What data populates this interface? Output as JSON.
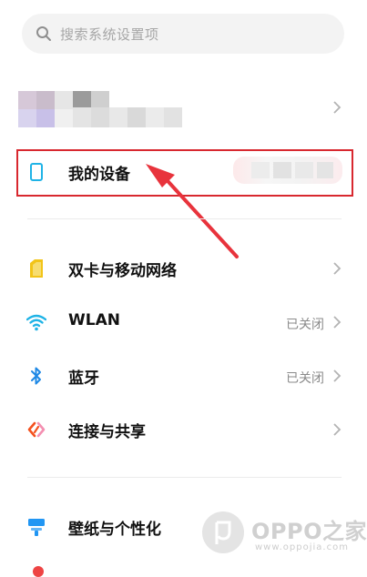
{
  "search": {
    "placeholder": "搜索系统设置项",
    "icon": "search-icon"
  },
  "device_row": {
    "label": "我的设备",
    "icon": "phone-icon"
  },
  "section1": [
    {
      "label": "双卡与移动网络",
      "status": "",
      "icon": "sim-card-icon",
      "color": "#f2c418"
    },
    {
      "label": "WLAN",
      "status": "已关闭",
      "icon": "wifi-icon",
      "color": "#1fb3e6"
    },
    {
      "label": "蓝牙",
      "status": "已关闭",
      "icon": "bluetooth-icon",
      "color": "#1e88e5"
    },
    {
      "label": "连接与共享",
      "status": "",
      "icon": "connection-share-icon",
      "color": "#f4511e"
    }
  ],
  "section2": [
    {
      "label": "壁纸与个性化",
      "status": "",
      "icon": "wallpaper-icon",
      "color": "#2196f3"
    }
  ],
  "watermark": {
    "brand": "OPPO之家",
    "url": "www.oppojia.com"
  },
  "colors": {
    "highlight": "#d8282f",
    "arrow": "#e8333c"
  }
}
